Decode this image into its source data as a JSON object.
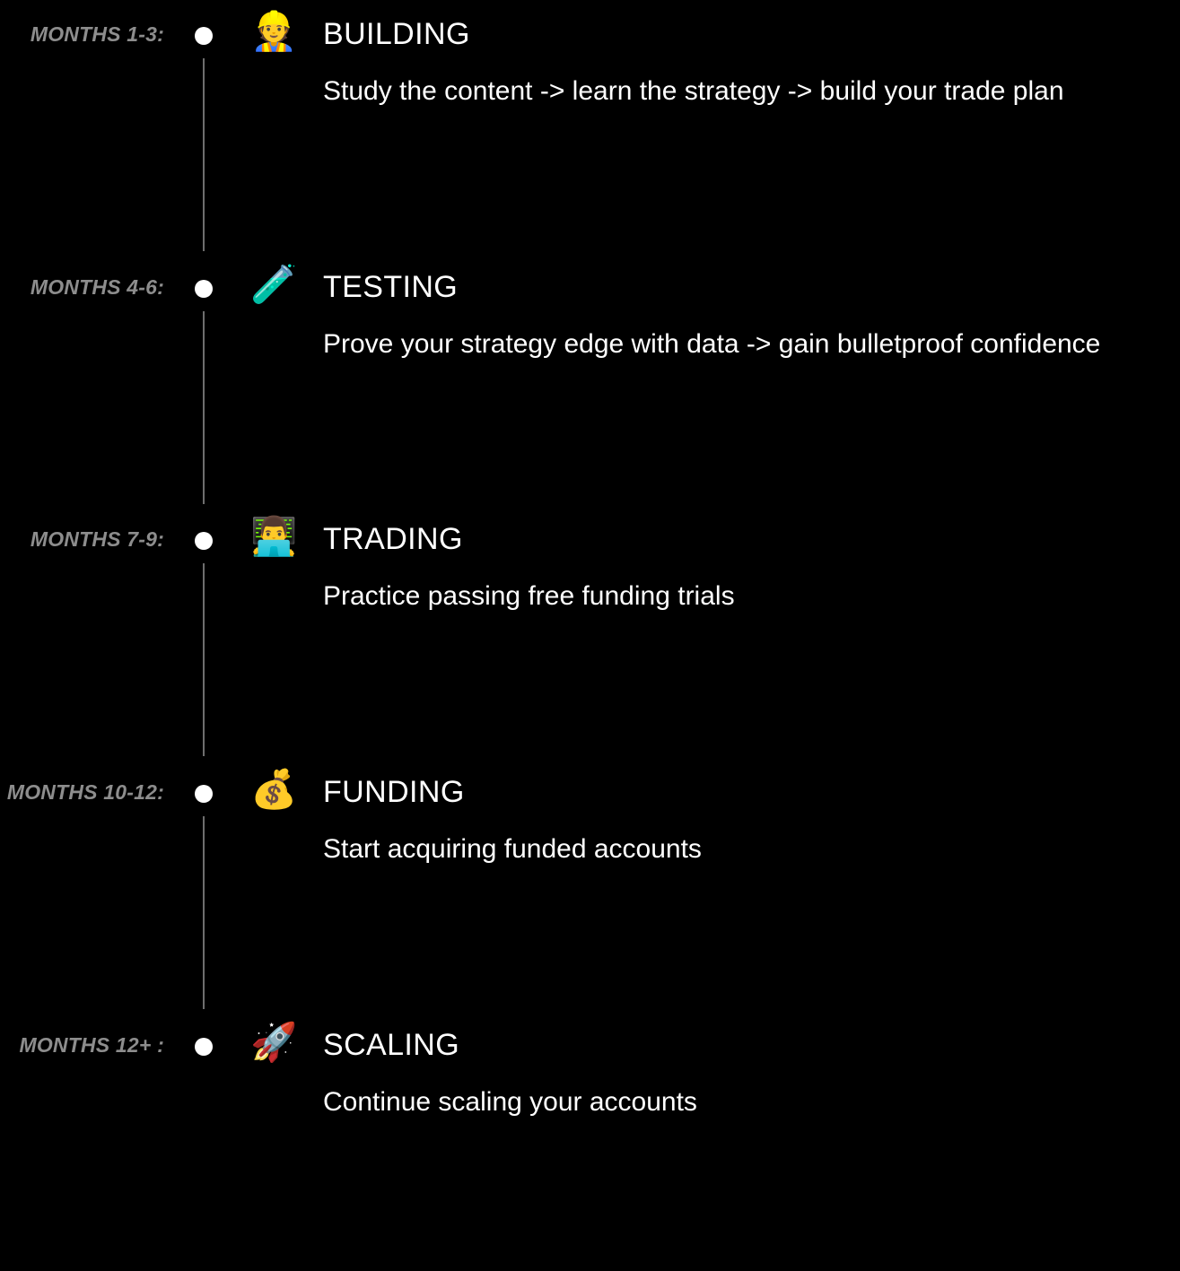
{
  "theme": {
    "background": "#000000",
    "text_color": "#ffffff",
    "label_color": "#8d8d8d",
    "connector_color": "#6e6e6e",
    "dot_color": "#ffffff"
  },
  "timeline": {
    "stages": [
      {
        "period": "MONTHS 1-3:",
        "icon": "construction-worker",
        "emoji": "👷",
        "title": "BUILDING",
        "description": "Study the content -> learn the strategy -> build your trade plan"
      },
      {
        "period": "MONTHS 4-6:",
        "icon": "test-tube",
        "emoji": "🧪",
        "title": "TESTING",
        "description": "Prove your strategy edge with data -> gain bulletproof confidence"
      },
      {
        "period": "MONTHS 7-9:",
        "icon": "man-technologist",
        "emoji": "👨‍💻",
        "title": "TRADING",
        "description": "Practice passing free funding trials"
      },
      {
        "period": "MONTHS 10-12:",
        "icon": "money-bag",
        "emoji": "💰",
        "title": "FUNDING",
        "description": "Start acquiring funded accounts"
      },
      {
        "period": "MONTHS 12+ :",
        "icon": "rocket",
        "emoji": "🚀",
        "title": "SCALING",
        "description": "Continue scaling your accounts"
      }
    ]
  }
}
